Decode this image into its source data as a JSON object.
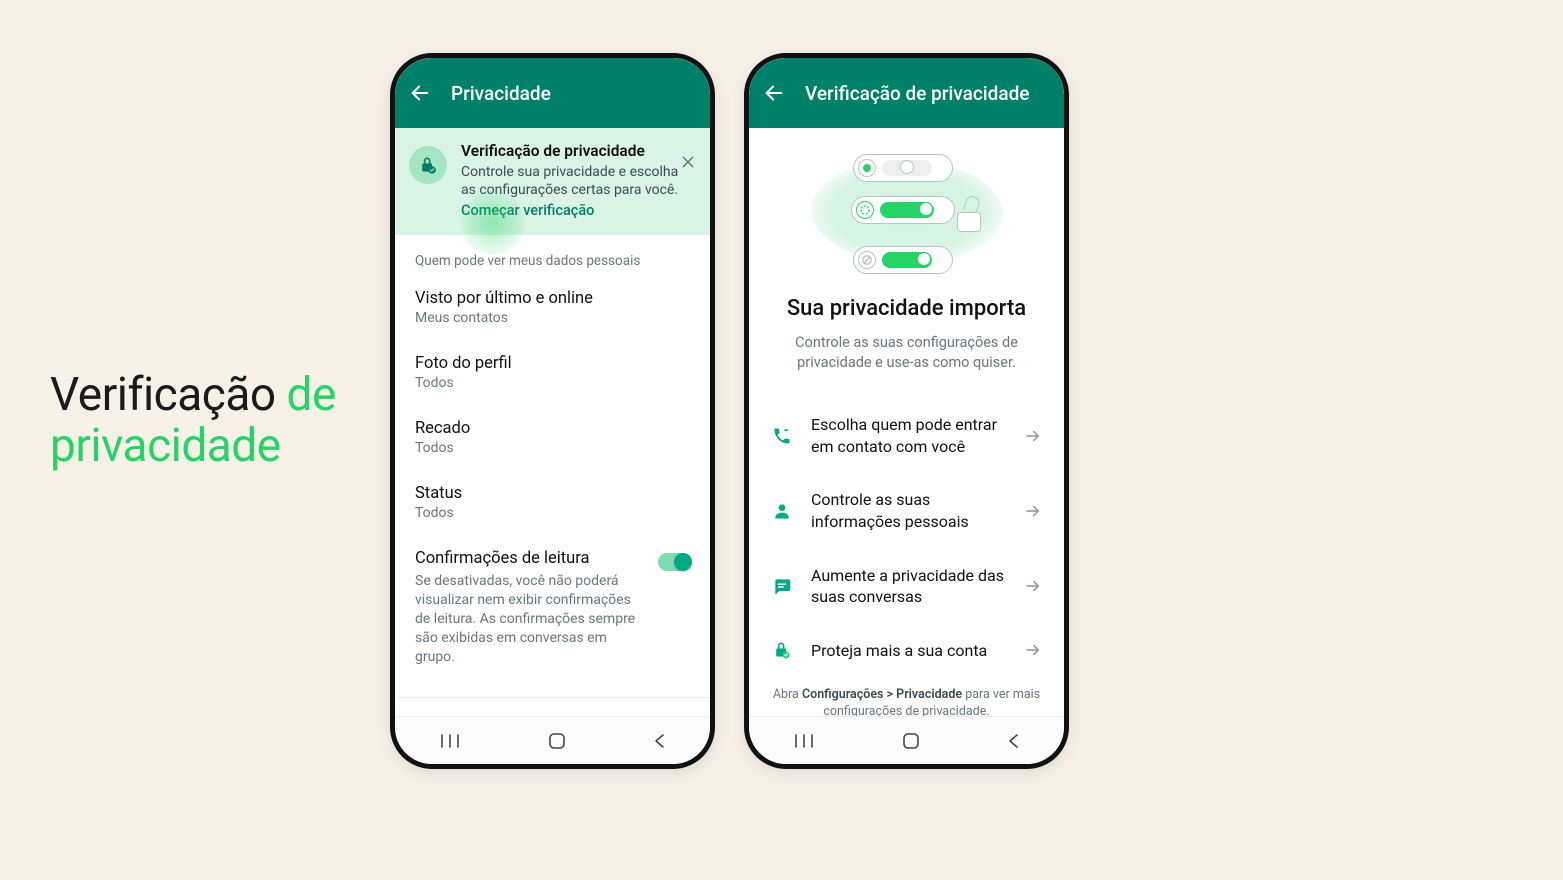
{
  "sideTitle": {
    "word1": "Verificação",
    "word2": "de",
    "word3": "privacidade"
  },
  "phone1": {
    "header": {
      "title": "Privacidade"
    },
    "banner": {
      "title": "Verificação de privacidade",
      "desc": "Controle sua privacidade e escolha as configurações certas para você.",
      "link": "Começar verificação"
    },
    "sectionLabel": "Quem pode ver meus dados pessoais",
    "items": {
      "lastSeen": {
        "title": "Visto por último e online",
        "sub": "Meus contatos"
      },
      "photo": {
        "title": "Foto do perfil",
        "sub": "Todos"
      },
      "about": {
        "title": "Recado",
        "sub": "Todos"
      },
      "status": {
        "title": "Status",
        "sub": "Todos"
      }
    },
    "readReceipts": {
      "title": "Confirmações de leitura",
      "desc": "Se desativadas, você não poderá visualizar nem exibir confirmações de leitura. As confirmações sempre são exibidas em conversas em grupo.",
      "enabled": true
    }
  },
  "phone2": {
    "header": {
      "title": "Verificação de privacidade"
    },
    "hero": {
      "title": "Sua privacidade importa",
      "desc": "Controle as suas configurações de privacidade e use-as como quiser."
    },
    "options": {
      "contact": "Escolha quem pode entrar em contato com você",
      "personal": "Controle as suas informações pessoais",
      "chats": "Aumente a privacidade das suas conversas",
      "account": "Proteja mais a sua conta"
    },
    "footnote": {
      "prefix": "Abra ",
      "bold": "Configurações > Privacidade",
      "suffix": " para ver mais configurações de privacidade."
    }
  }
}
